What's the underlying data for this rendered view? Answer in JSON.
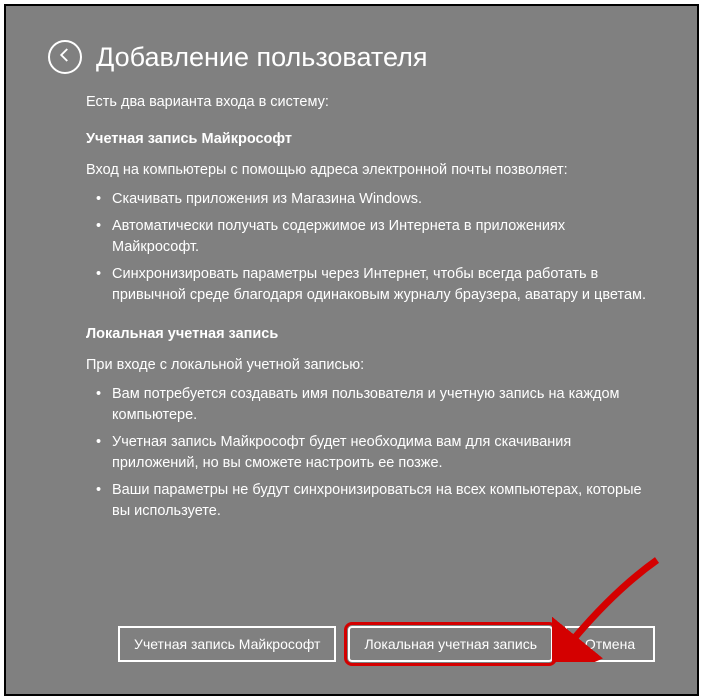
{
  "header": {
    "title": "Добавление пользователя"
  },
  "intro": "Есть два варианта входа в систему:",
  "section_ms": {
    "heading": "Учетная запись Майкрософт",
    "sub": "Вход на компьютеры с помощью адреса электронной почты позволяет:",
    "items": [
      "Скачивать приложения из Магазина Windows.",
      "Автоматически получать содержимое из Интернета в приложениях Майкрософт.",
      "Синхронизировать параметры через Интернет, чтобы всегда работать в привычной среде благодаря одинаковым журналу браузера, аватару и цветам."
    ]
  },
  "section_local": {
    "heading": "Локальная учетная запись",
    "sub": "При входе с локальной учетной записью:",
    "items": [
      "Вам потребуется создавать имя пользователя и учетную запись на каждом компьютере.",
      "Учетная запись Майкрософт будет необходима вам для скачивания приложений, но вы сможете настроить ее позже.",
      "Ваши параметры не будут синхронизироваться на всех компьютерах, которые вы используете."
    ]
  },
  "buttons": {
    "ms": "Учетная запись Майкрософт",
    "local": "Локальная учетная запись",
    "cancel": "Отмена"
  }
}
